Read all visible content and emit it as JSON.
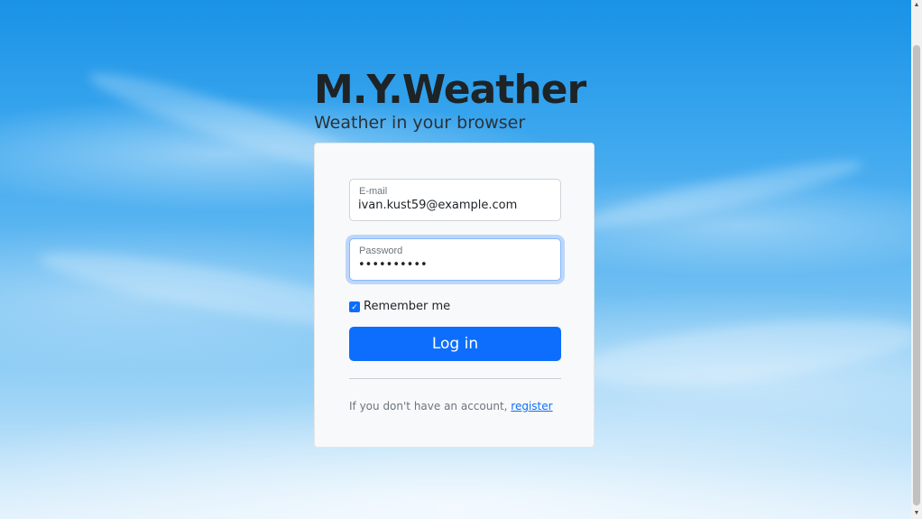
{
  "brand": {
    "title": "M.Y.Weather",
    "subtitle": "Weather in your browser"
  },
  "login_form": {
    "email": {
      "label": "E-mail",
      "value": "ivan.kust59@example.com"
    },
    "password": {
      "label": "Password",
      "value": "••••••••••",
      "focused": true
    },
    "remember": {
      "label": "Remember me",
      "checked": true
    },
    "submit_label": "Log in",
    "register_prompt": "If you don't have an account, ",
    "register_link": "register"
  },
  "colors": {
    "accent": "#0d6efd",
    "card_bg": "#f8f9fa",
    "title": "#1e2326",
    "sky_top": "#1a92e6",
    "sky_bottom": "#dff0fc"
  },
  "icons": {
    "checkbox": "check-icon",
    "scroll_up": "scroll-up-arrow-icon",
    "scroll_down": "scroll-down-arrow-icon"
  }
}
